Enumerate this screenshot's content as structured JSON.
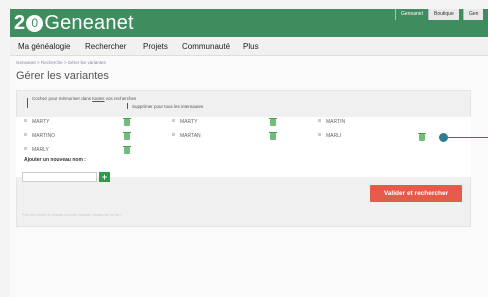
{
  "header": {
    "logo_prefix": "2",
    "logo_circle": "0",
    "logo_text": "Geneanet",
    "tabs": [
      "Geneanet",
      "Boutique",
      "Gen"
    ]
  },
  "nav": {
    "items": [
      "Ma généalogie",
      "Rechercher",
      "Projets",
      "Communauté",
      "Plus"
    ]
  },
  "breadcrumb": "Geneanet > Recherche > Gérer les variantes",
  "page_title": "Gérer les variantes",
  "notes": {
    "memo_before": "Cochez pour mémoriser dans ",
    "memo_link": "toutes",
    "memo_after": " vos recherches",
    "delete_all": "Supprimer pour tous les internautes"
  },
  "variants": [
    {
      "name": "MARTY"
    },
    {
      "name": "MARTINO"
    },
    {
      "name": "MARTAN"
    },
    {
      "name": "MARTY"
    },
    {
      "name": "MARTIN"
    },
    {
      "name": "MARLI"
    },
    {
      "name": "MARLY"
    }
  ],
  "add": {
    "label": "Ajouter un nouveau nom :",
    "placeholder": "",
    "button": "+"
  },
  "validate_button": "Valider et rechercher",
  "footnote": "Pour être averti de chaque nouvelle variante, cliquez sur ce lien.",
  "colors": {
    "brand": "#3f8c5f",
    "validate": "#e55b4b",
    "add": "#2f9a4a",
    "callout": "#2e7d8c"
  }
}
